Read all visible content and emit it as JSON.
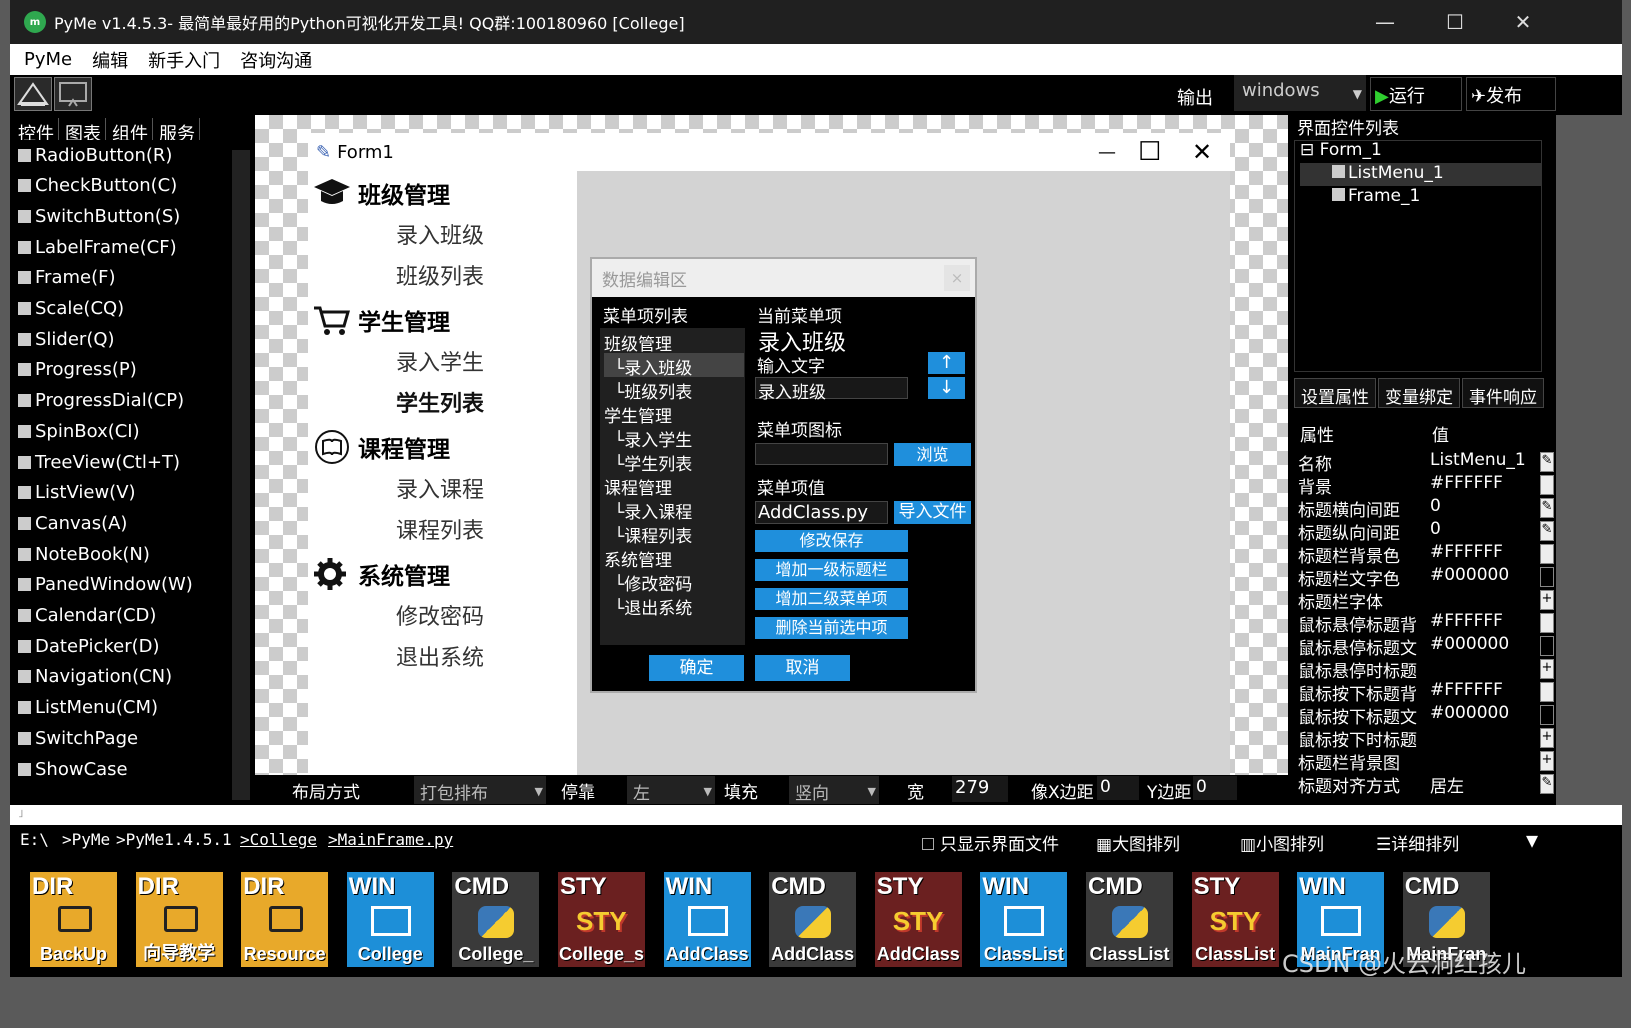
{
  "window": {
    "title": "PyMe v1.4.5.3- 最简单最好用的Python可视化开发工具! QQ群:100180960    [College]",
    "min": "—",
    "max": "☐",
    "close": "✕"
  },
  "menu": [
    "PyMe",
    "编辑",
    "新手入门",
    "咨询沟通"
  ],
  "toolbar": {
    "output": "输出",
    "platform": "windows",
    "run": "▶运行",
    "publish": "✈发布"
  },
  "left": {
    "tabs": [
      "控件",
      "图表",
      "组件",
      "服务"
    ],
    "items": [
      "RadioButton(R)",
      "CheckButton(C)",
      "SwitchButton(S)",
      "LabelFrame(CF)",
      "Frame(F)",
      "Scale(CQ)",
      "Slider(Q)",
      "Progress(P)",
      "ProgressDial(CP)",
      "SpinBox(CI)",
      "TreeView(Ctl+T)",
      "ListView(V)",
      "Canvas(A)",
      "NoteBook(N)",
      "PanedWindow(W)",
      "Calendar(CD)",
      "DatePicker(D)",
      "Navigation(CN)",
      "ListMenu(CM)",
      "SwitchPage",
      "ShowCase"
    ]
  },
  "form": {
    "title": "Form1",
    "min": "—",
    "max": "☐",
    "close": "✕",
    "groups": [
      {
        "title": "班级管理",
        "items": [
          "录入班级",
          "班级列表"
        ]
      },
      {
        "title": "学生管理",
        "items": [
          "录入学生",
          "学生列表"
        ]
      },
      {
        "title": "课程管理",
        "items": [
          "录入课程",
          "课程列表"
        ]
      },
      {
        "title": "系统管理",
        "items": [
          "修改密码",
          "退出系统"
        ]
      }
    ]
  },
  "dialog": {
    "title": "数据编辑区",
    "close": "×",
    "list_label": "菜单项列表",
    "tree": [
      "班级管理",
      "└录入班级",
      "└班级列表",
      "学生管理",
      "└录入学生",
      "└学生列表",
      "课程管理",
      "└录入课程",
      "└课程列表",
      "系统管理",
      "└修改密码",
      "└退出系统"
    ],
    "current_label": "当前菜单项",
    "current_value": "录入班级",
    "input_label": "输入文字",
    "input_value": "录入班级",
    "up": "↑",
    "down": "↓",
    "icon_label": "菜单项图标",
    "browse": "浏览",
    "value_label": "菜单项值",
    "value": "AddClass.py",
    "import": "导入文件",
    "actions": [
      "修改保存",
      "增加一级标题栏",
      "增加二级菜单项",
      "删除当前选中项"
    ],
    "ok": "确定",
    "cancel": "取消"
  },
  "bottom": {
    "layout_label": "布局方式",
    "layout_value": "打包排布",
    "dock_label": "停靠",
    "dock_value": "左",
    "fill_label": "填充",
    "fill_value": "竖向",
    "width_label": "宽",
    "width_value": "279",
    "padx_label": "像X边距",
    "padx_value": "0",
    "pady_label": "Y边距",
    "pady_value": "0"
  },
  "path": {
    "parts": [
      "E:\\",
      ">PyMe",
      ">PyMe1.4.5.1",
      ">College",
      ">MainFrame.py"
    ],
    "only_ui": "只显示界面文件",
    "big": "大图排列",
    "small": "小图排列",
    "detail": "详细排列"
  },
  "files": [
    {
      "tag": "DIR",
      "name": "BackUp",
      "color": "#e8a92a"
    },
    {
      "tag": "DIR",
      "name": "向导教学",
      "color": "#e8a92a"
    },
    {
      "tag": "DIR",
      "name": "Resource",
      "color": "#e8a92a"
    },
    {
      "tag": "WIN",
      "name": "College",
      "color": "#1d8fd8"
    },
    {
      "tag": "CMD",
      "name": "College_",
      "color": "#3a3a3a"
    },
    {
      "tag": "STY",
      "name": "College_s",
      "color": "#6b2020"
    },
    {
      "tag": "WIN",
      "name": "AddClass",
      "color": "#1d8fd8"
    },
    {
      "tag": "CMD",
      "name": "AddClass",
      "color": "#3a3a3a"
    },
    {
      "tag": "STY",
      "name": "AddClass",
      "color": "#6b2020"
    },
    {
      "tag": "WIN",
      "name": "ClassList",
      "color": "#1d8fd8"
    },
    {
      "tag": "CMD",
      "name": "ClassList",
      "color": "#3a3a3a"
    },
    {
      "tag": "STY",
      "name": "ClassList",
      "color": "#6b2020"
    },
    {
      "tag": "WIN",
      "name": "MainFran",
      "color": "#1d8fd8"
    },
    {
      "tag": "CMD",
      "name": "MainFran",
      "color": "#3a3a3a"
    }
  ],
  "watermark": "CSDN @火云洞红孩儿",
  "right": {
    "title": "界面控件列表",
    "tree": [
      "⊟ Form_1",
      "ListMenu_1",
      "Frame_1"
    ],
    "tabs": [
      "设置属性",
      "变量绑定",
      "事件响应"
    ],
    "prop_header": "属性",
    "value_header": "值",
    "props": [
      {
        "k": "名称",
        "v": "ListMenu_1"
      },
      {
        "k": "背景",
        "v": "#FFFFFF"
      },
      {
        "k": "标题横向间距",
        "v": "0"
      },
      {
        "k": "标题纵向间距",
        "v": "0"
      },
      {
        "k": "标题栏背景色",
        "v": "#FFFFFF"
      },
      {
        "k": "标题栏文字色",
        "v": "#000000"
      },
      {
        "k": "标题栏字体",
        "v": ""
      },
      {
        "k": "鼠标悬停标题背",
        "v": "#FFFFFF"
      },
      {
        "k": "鼠标悬停标题文",
        "v": "#000000"
      },
      {
        "k": "鼠标悬停时标题",
        "v": ""
      },
      {
        "k": "鼠标按下标题背",
        "v": "#FFFFFF"
      },
      {
        "k": "鼠标按下标题文",
        "v": "#000000"
      },
      {
        "k": "鼠标按下时标题",
        "v": ""
      },
      {
        "k": "标题栏背景图",
        "v": ""
      },
      {
        "k": "标题对齐方式",
        "v": "居左"
      }
    ]
  }
}
